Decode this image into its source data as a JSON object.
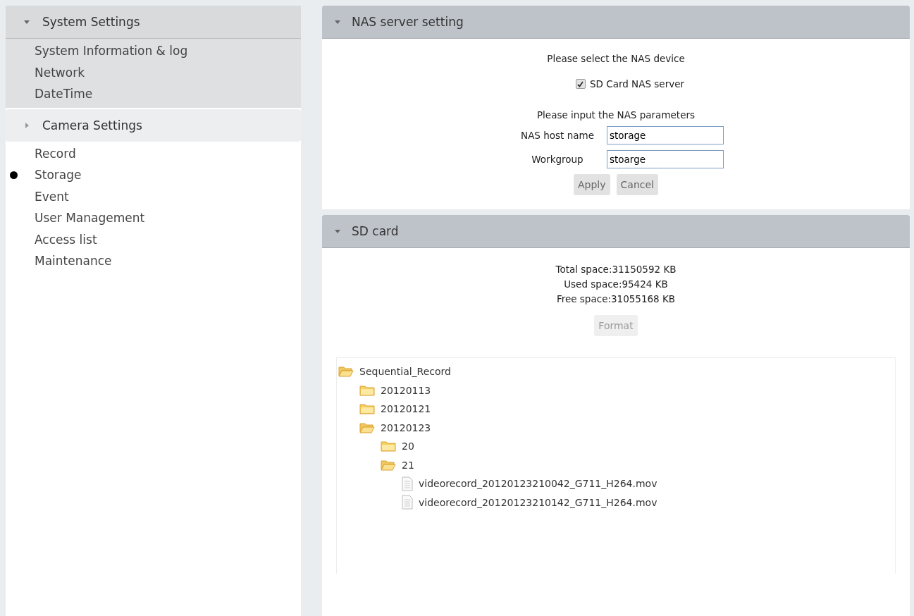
{
  "sidebar": {
    "groups": [
      {
        "title": "System Settings",
        "expanded": true,
        "items": [
          {
            "label": "System Information & log",
            "selected": false
          },
          {
            "label": "Network",
            "selected": false
          },
          {
            "label": "DateTime",
            "selected": false
          }
        ]
      },
      {
        "title": "Camera Settings",
        "expanded": false,
        "items": [
          {
            "label": "Record",
            "selected": false
          },
          {
            "label": "Storage",
            "selected": true
          },
          {
            "label": "Event",
            "selected": false
          },
          {
            "label": "User Management",
            "selected": false
          },
          {
            "label": "Access list",
            "selected": false
          },
          {
            "label": "Maintenance",
            "selected": false
          }
        ]
      }
    ]
  },
  "nas_panel": {
    "title": "NAS server setting",
    "expanded": true,
    "select_prompt": "Please select the NAS device",
    "sd_option": {
      "label": "SD Card NAS server",
      "checked": true
    },
    "params_prompt": "Please input the NAS parameters",
    "fields": [
      {
        "label": "NAS host name",
        "value": "storage"
      },
      {
        "label": "Workgroup",
        "value": "stoarge"
      }
    ],
    "buttons": [
      {
        "label": "Apply",
        "disabled": false
      },
      {
        "label": "Cancel",
        "disabled": false
      }
    ]
  },
  "sd_panel": {
    "title": "SD card",
    "expanded": true,
    "stats": [
      "Total space:31150592 KB",
      "Used space:95424 KB",
      "Free space:31055168 KB"
    ],
    "format_button": {
      "label": "Format",
      "disabled": true
    },
    "tree": [
      {
        "kind": "folder",
        "name": "Sequential_Record",
        "expanded": true,
        "children": [
          {
            "kind": "folder",
            "name": "20120113",
            "expanded": false
          },
          {
            "kind": "folder",
            "name": "20120121",
            "expanded": false
          },
          {
            "kind": "folder",
            "name": "20120123",
            "expanded": true,
            "children": [
              {
                "kind": "folder",
                "name": "20",
                "expanded": false
              },
              {
                "kind": "folder",
                "name": "21",
                "expanded": true,
                "children": [
                  {
                    "kind": "file",
                    "name": "videorecord_20120123210042_G711_H264.mov"
                  },
                  {
                    "kind": "file",
                    "name": "videorecord_20120123210142_G711_H264.mov"
                  }
                ]
              }
            ]
          }
        ]
      }
    ]
  }
}
